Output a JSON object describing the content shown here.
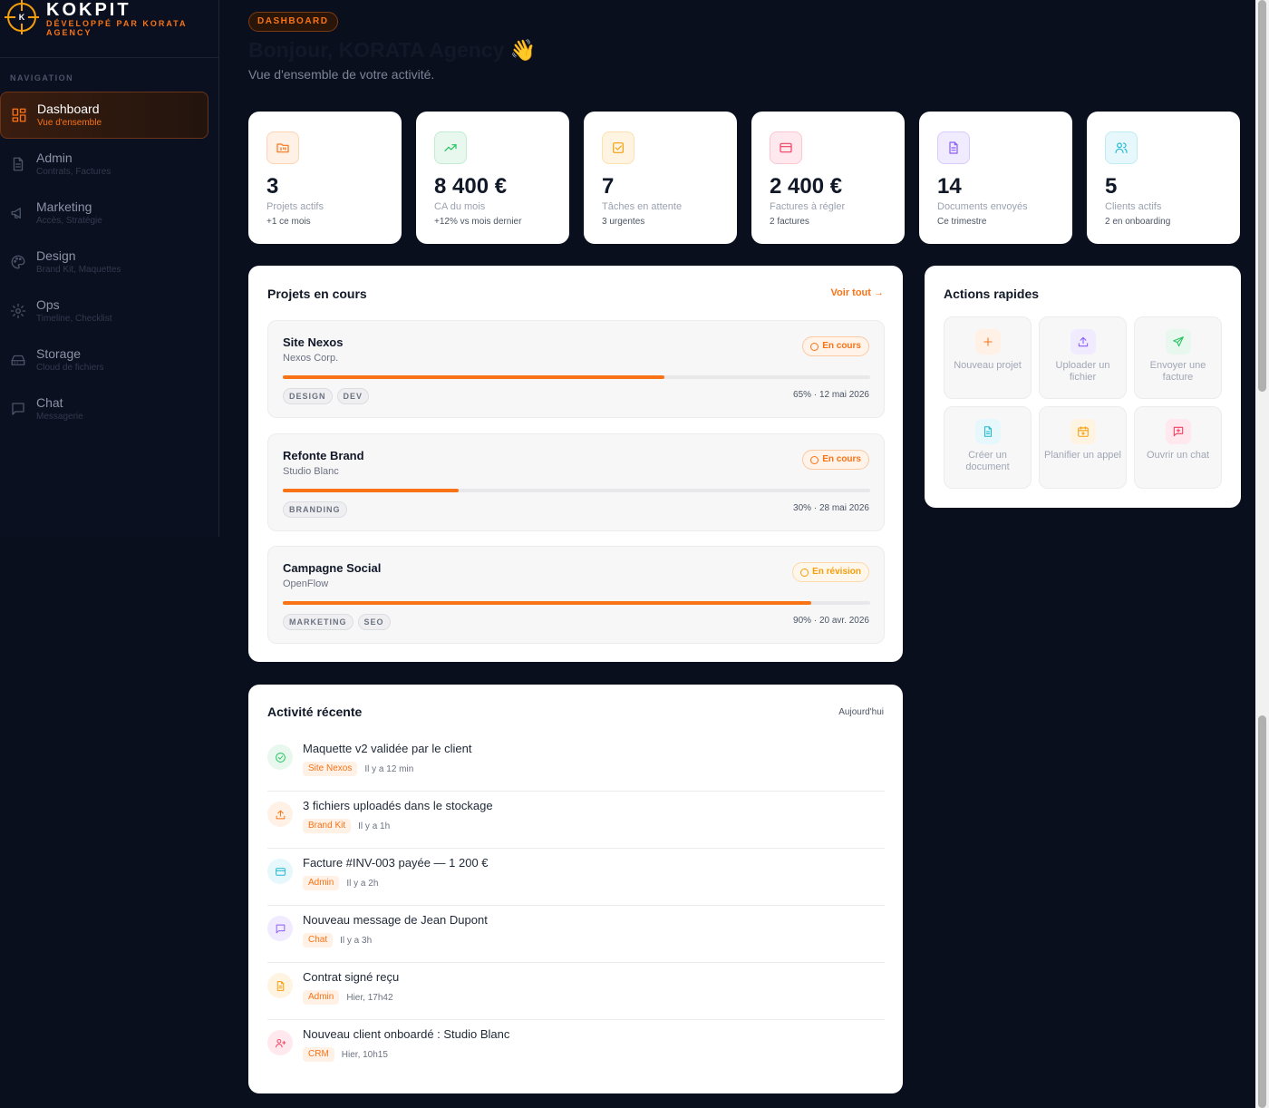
{
  "brand": {
    "name": "KOKPIT",
    "tagline": "DÉVELOPPÉ PAR KORATA AGENCY",
    "logo_letter": "K"
  },
  "nav": {
    "label": "NAVIGATION",
    "items": [
      {
        "title": "Dashboard",
        "sub": "Vue d'ensemble",
        "icon": "grid-icon",
        "active": true
      },
      {
        "title": "Admin",
        "sub": "Contrats, Factures",
        "icon": "document-icon"
      },
      {
        "title": "Marketing",
        "sub": "Accès, Stratégie",
        "icon": "megaphone-icon"
      },
      {
        "title": "Design",
        "sub": "Brand Kit, Maquettes",
        "icon": "palette-icon"
      },
      {
        "title": "Ops",
        "sub": "Timeline, Checklist",
        "icon": "gear-icon"
      },
      {
        "title": "Storage",
        "sub": "Cloud de fichiers",
        "icon": "drive-icon"
      },
      {
        "title": "Chat",
        "sub": "Messagerie",
        "icon": "chat-icon"
      }
    ]
  },
  "header": {
    "badge": "DASHBOARD",
    "greeting": "Bonjour, KORATA Agency",
    "wave": "👋",
    "subtitle": "Vue d'ensemble de votre activité."
  },
  "stats": [
    {
      "value": "3",
      "label": "Projets actifs",
      "note": "+1 ce mois",
      "icon": "kanban-icon",
      "color": "#f97316"
    },
    {
      "value": "8 400 €",
      "label": "CA du mois",
      "note": "+12% vs mois dernier",
      "icon": "trend-up-icon",
      "color": "#22c55e"
    },
    {
      "value": "7",
      "label": "Tâches en attente",
      "note": "3 urgentes",
      "icon": "checkbox-icon",
      "color": "#f59e0b"
    },
    {
      "value": "2 400 €",
      "label": "Factures à régler",
      "note": "2 factures",
      "icon": "credit-card-icon",
      "color": "#f43f5e"
    },
    {
      "value": "14",
      "label": "Documents envoyés",
      "note": "Ce trimestre",
      "icon": "file-icon",
      "color": "#8b5cf6"
    },
    {
      "value": "5",
      "label": "Clients actifs",
      "note": "2 en onboarding",
      "icon": "users-icon",
      "color": "#22b8cf"
    }
  ],
  "projects": {
    "title": "Projets en cours",
    "view_all": "Voir tout →",
    "items": [
      {
        "name": "Site Nexos",
        "client": "Nexos Corp.",
        "status": "En cours",
        "status_type": "progress",
        "progress": 65,
        "tags": [
          "DESIGN",
          "DEV"
        ],
        "meta": "65% · 12 mai 2026"
      },
      {
        "name": "Refonte Brand",
        "client": "Studio Blanc",
        "status": "En cours",
        "status_type": "progress",
        "progress": 30,
        "tags": [
          "BRANDING"
        ],
        "meta": "30% · 28 mai 2026"
      },
      {
        "name": "Campagne Social",
        "client": "OpenFlow",
        "status": "En révision",
        "status_type": "review",
        "progress": 90,
        "tags": [
          "MARKETING",
          "SEO"
        ],
        "meta": "90% · 20 avr. 2026"
      }
    ]
  },
  "quick_actions": {
    "title": "Actions rapides",
    "items": [
      {
        "label": "Nouveau projet",
        "icon": "plus-icon",
        "color": "#f97316",
        "bg": "#fff1e6"
      },
      {
        "label": "Uploader un fichier",
        "icon": "upload-icon",
        "color": "#8b5cf6",
        "bg": "#f1ebff"
      },
      {
        "label": "Envoyer une facture",
        "icon": "send-icon",
        "color": "#22c55e",
        "bg": "#e8f8ee"
      },
      {
        "label": "Créer un document",
        "icon": "file-icon",
        "color": "#22b8cf",
        "bg": "#e6f8fb"
      },
      {
        "label": "Planifier un appel",
        "icon": "calendar-icon",
        "color": "#f59e0b",
        "bg": "#fff4e2"
      },
      {
        "label": "Ouvrir un chat",
        "icon": "chat-plus-icon",
        "color": "#f43f5e",
        "bg": "#ffe9ee"
      }
    ]
  },
  "activity": {
    "title": "Activité récente",
    "period": "Aujourd'hui",
    "items": [
      {
        "title": "Maquette v2 validée par le client",
        "tag": "Site Nexos",
        "time": "Il y a 12 min",
        "icon": "check-circle-icon",
        "color": "#22c55e",
        "bg": "#e8f8ee"
      },
      {
        "title": "3 fichiers uploadés dans le stockage",
        "tag": "Brand Kit",
        "time": "Il y a 1h",
        "icon": "upload-icon",
        "color": "#f97316",
        "bg": "#fff1e6"
      },
      {
        "title": "Facture #INV-003 payée — 1 200 €",
        "tag": "Admin",
        "time": "Il y a 2h",
        "icon": "credit-card-icon",
        "color": "#22b8cf",
        "bg": "#e6f8fb"
      },
      {
        "title": "Nouveau message de Jean Dupont",
        "tag": "Chat",
        "time": "Il y a 3h",
        "icon": "chat-icon",
        "color": "#8b5cf6",
        "bg": "#f1ebff"
      },
      {
        "title": "Contrat signé reçu",
        "tag": "Admin",
        "time": "Hier, 17h42",
        "icon": "file-icon",
        "color": "#f59e0b",
        "bg": "#fff4e2"
      },
      {
        "title": "Nouveau client onboardé : Studio Blanc",
        "tag": "CRM",
        "time": "Hier, 10h15",
        "icon": "user-plus-icon",
        "color": "#f43f5e",
        "bg": "#ffe9ee"
      }
    ]
  }
}
